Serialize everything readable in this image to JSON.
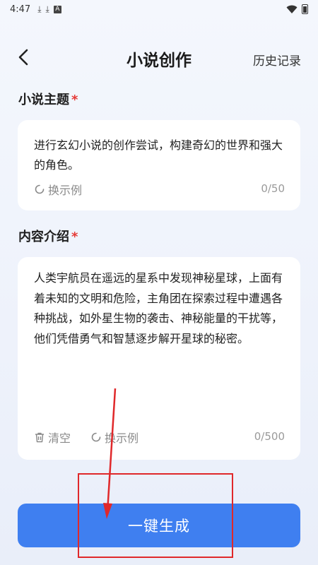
{
  "status_bar": {
    "time": "4:47",
    "icons": [
      "download-icon",
      "download-icon",
      "text-a-icon",
      "wifi-icon",
      "battery-icon"
    ]
  },
  "header": {
    "title": "小说创作",
    "history_label": "历史记录"
  },
  "theme_section": {
    "label": "小说主题",
    "required_mark": "*",
    "content": "进行玄幻小说的创作尝试，构建奇幻的世界和强大的角色。",
    "example_button": "换示例",
    "counter": "0/50"
  },
  "intro_section": {
    "label": "内容介绍",
    "required_mark": "*",
    "content": "人类宇航员在遥远的星系中发现神秘星球，上面有着未知的文明和危险，主角团在探索过程中遭遇各种挑战，如外星生物的袭击、神秘能量的干扰等，他们凭借勇气和智慧逐步解开星球的秘密。",
    "clear_button": "清空",
    "example_button": "换示例",
    "counter": "0/500"
  },
  "generate_button": "一键生成",
  "colors": {
    "accent": "#3f7ff0",
    "required": "#e53935",
    "annotation": "#e0282a"
  }
}
